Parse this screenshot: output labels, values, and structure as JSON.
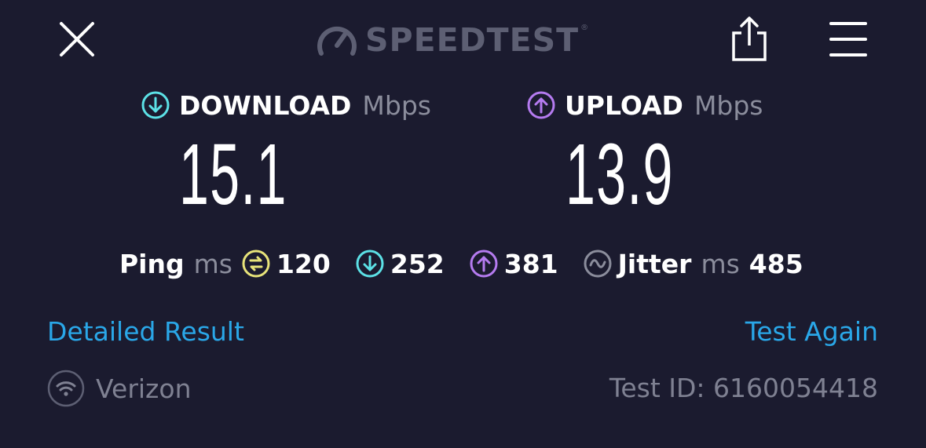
{
  "header": {
    "logo_text": "SPEEDTEST",
    "logo_tm": "®"
  },
  "download": {
    "label": "DOWNLOAD",
    "unit": "Mbps",
    "value": "15.1"
  },
  "upload": {
    "label": "UPLOAD",
    "unit": "Mbps",
    "value": "13.9"
  },
  "ping": {
    "label": "Ping",
    "unit": "ms",
    "idle": "120",
    "download": "252",
    "upload": "381"
  },
  "jitter": {
    "label": "Jitter",
    "unit": "ms",
    "value": "485"
  },
  "links": {
    "detailed_result": "Detailed Result",
    "test_again": "Test Again"
  },
  "footer": {
    "provider": "Verizon",
    "test_id": "Test ID: 6160054418"
  },
  "colors": {
    "background": "#1b1b2f",
    "download_accent": "#5ce1e6",
    "upload_accent": "#b57bf0",
    "ping_idle_accent": "#e8e47a",
    "link": "#2aa7e8"
  },
  "icons": {
    "close": "close-icon",
    "logo": "speedometer-icon",
    "share": "share-icon",
    "menu": "menu-icon",
    "download": "download-arrow-icon",
    "upload": "upload-arrow-icon",
    "ping_idle": "idle-ping-icon",
    "jitter": "jitter-icon",
    "wifi": "wifi-icon"
  }
}
